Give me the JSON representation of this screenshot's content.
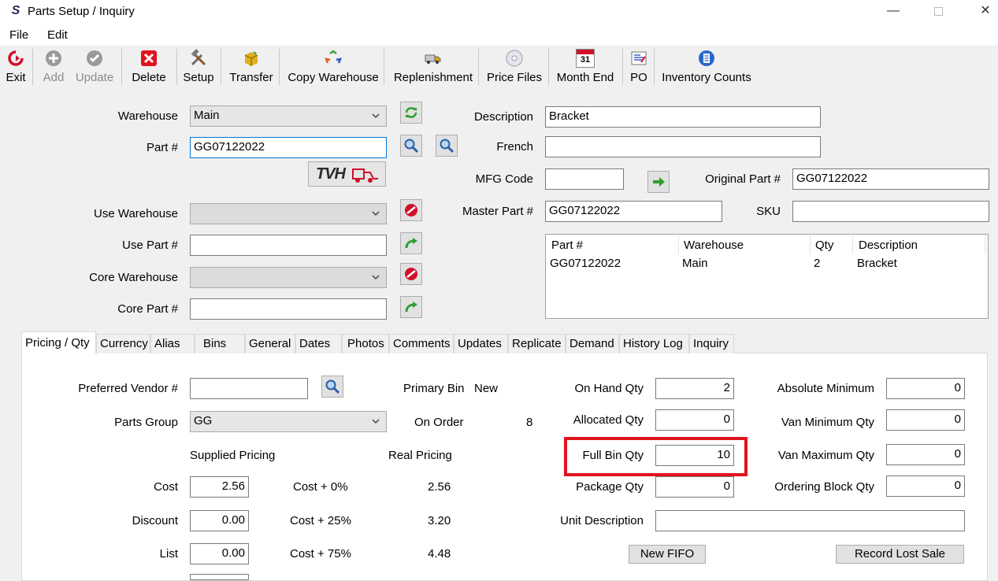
{
  "window": {
    "title": "Parts Setup / Inquiry",
    "app_icon": "S"
  },
  "menu": {
    "file": "File",
    "edit": "Edit"
  },
  "toolbar": {
    "exit": "Exit",
    "add": "Add",
    "update": "Update",
    "delete": "Delete",
    "setup": "Setup",
    "transfer": "Transfer",
    "copy_warehouse": "Copy Warehouse",
    "replenishment": "Replenishment",
    "price_files": "Price Files",
    "month_end": "Month End",
    "month_end_day": "31",
    "po": "PO",
    "inventory_counts": "Inventory Counts"
  },
  "form": {
    "warehouse_label": "Warehouse",
    "warehouse_value": "Main",
    "part_label": "Part #",
    "part_value": "GG07122022",
    "use_warehouse_label": "Use Warehouse",
    "use_part_label": "Use Part #",
    "core_warehouse_label": "Core Warehouse",
    "core_part_label": "Core Part #",
    "description_label": "Description",
    "description_value": "Bracket",
    "french_label": "French",
    "french_value": "",
    "mfg_code_label": "MFG Code",
    "mfg_code_value": "",
    "original_part_label": "Original Part #",
    "original_part_value": "GG07122022",
    "master_part_label": "Master Part #",
    "master_part_value": "GG07122022",
    "sku_label": "SKU",
    "sku_value": "",
    "tvh_logo": "TVH"
  },
  "list": {
    "columns": [
      "Part #",
      "Warehouse",
      "Qty",
      "Description"
    ],
    "rows": [
      [
        "GG07122022",
        "Main",
        "2",
        "Bracket"
      ]
    ]
  },
  "tabs": [
    "Pricing / Qty",
    "Currency",
    "Alias",
    "Bins",
    "General",
    "Dates",
    "Photos",
    "Comments",
    "Updates",
    "Replicate",
    "Demand",
    "History Log",
    "Inquiry"
  ],
  "pricing": {
    "preferred_vendor_label": "Preferred Vendor #",
    "preferred_vendor_value": "",
    "parts_group_label": "Parts Group",
    "parts_group_value": "GG",
    "primary_bin_label": "Primary Bin",
    "primary_bin_value": "New",
    "on_order_label": "On Order",
    "on_order_value": "8",
    "supplied_pricing": "Supplied Pricing",
    "real_pricing": "Real Pricing",
    "cost_label": "Cost",
    "cost_value": "2.56",
    "discount_label": "Discount",
    "discount_value": "0.00",
    "list_label": "List",
    "list_value": "0.00",
    "cost0_label": "Cost + 0%",
    "cost0_value": "2.56",
    "cost25_label": "Cost + 25%",
    "cost25_value": "3.20",
    "cost75_label": "Cost + 75%",
    "cost75_value": "4.48",
    "on_hand_label": "On Hand Qty",
    "on_hand_value": "2",
    "allocated_label": "Allocated Qty",
    "allocated_value": "0",
    "full_bin_label": "Full Bin Qty",
    "full_bin_value": "10",
    "package_label": "Package Qty",
    "package_value": "0",
    "unit_desc_label": "Unit Description",
    "unit_desc_value": "",
    "abs_min_label": "Absolute Minimum",
    "abs_min_value": "0",
    "van_min_label": "Van Minimum Qty",
    "van_min_value": "0",
    "van_max_label": "Van Maximum Qty",
    "van_max_value": "0",
    "ordering_block_label": "Ordering Block Qty",
    "ordering_block_value": "0",
    "new_fifo": "New FIFO",
    "record_lost_sale": "Record Lost Sale"
  },
  "colors": {
    "highlight": "#e0141e",
    "accent": "#0078d7"
  }
}
